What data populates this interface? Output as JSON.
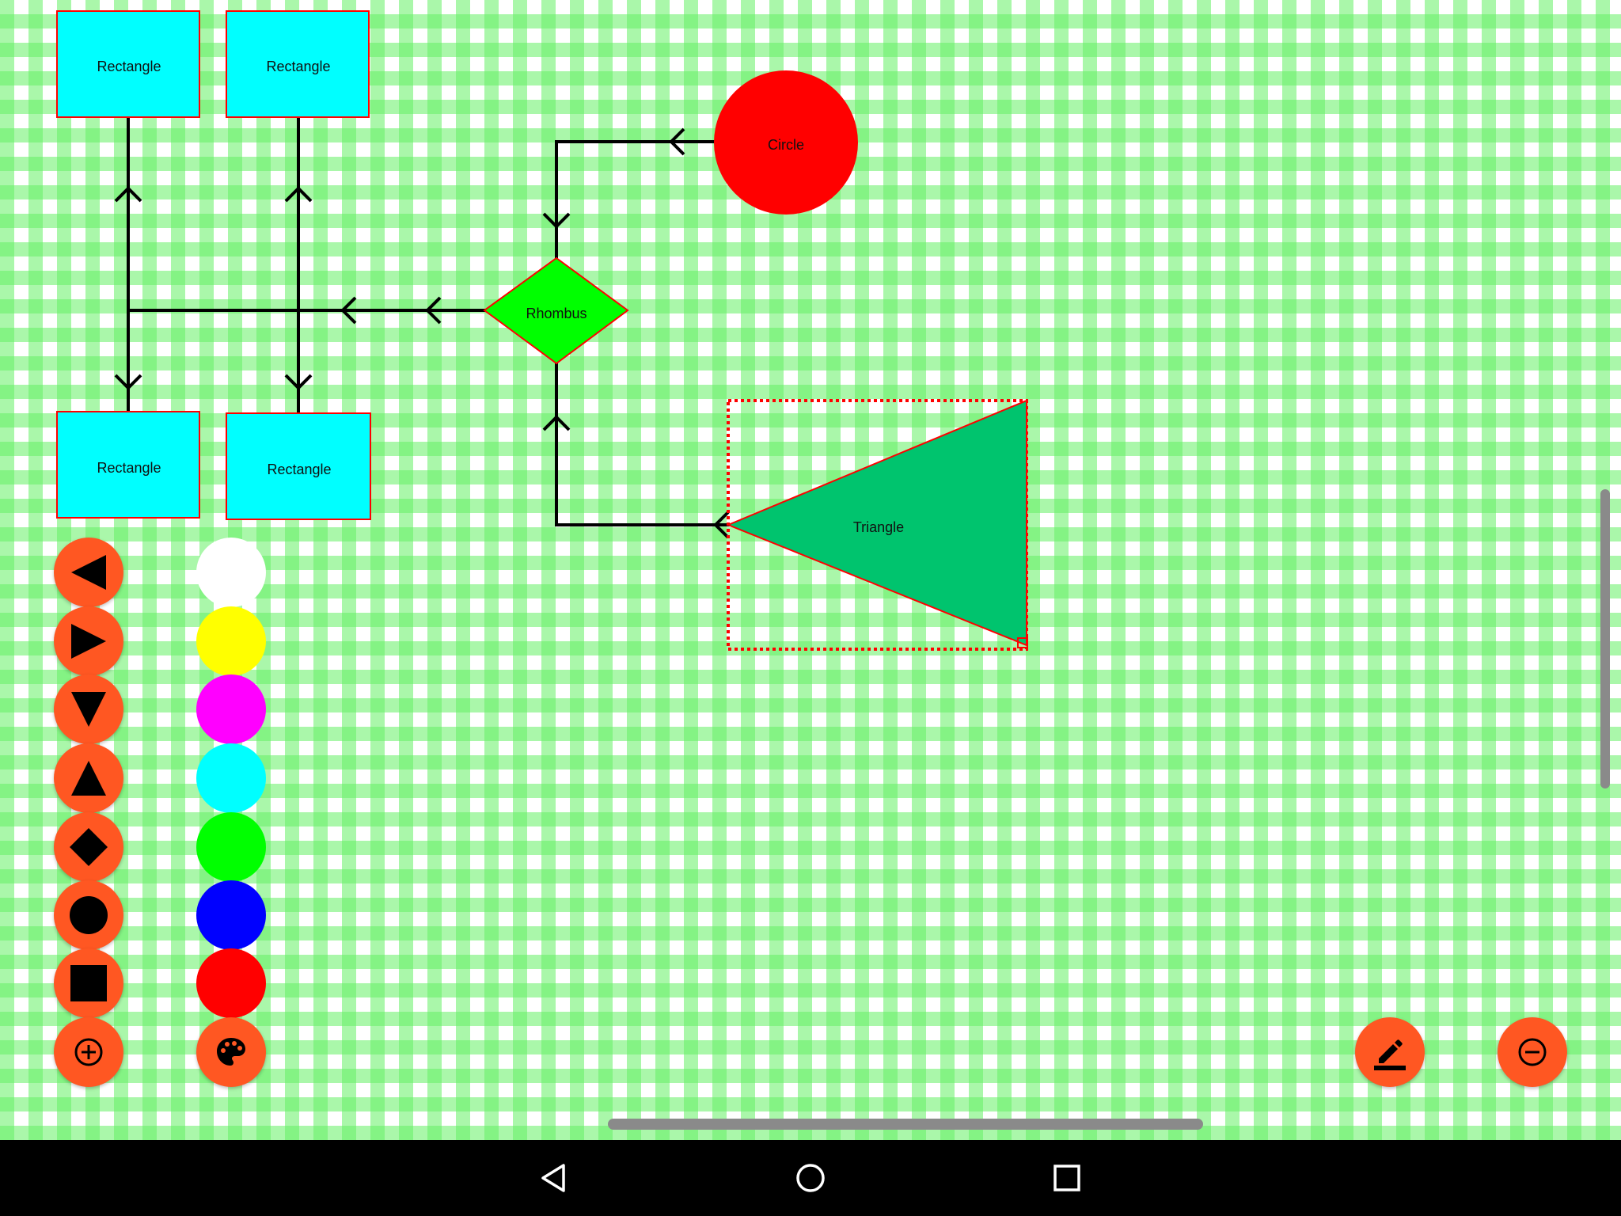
{
  "canvas": {
    "shapes": [
      {
        "id": "rect-1",
        "type": "rectangle",
        "label": "Rectangle",
        "fill": "#00ffff",
        "stroke": "#ff0000"
      },
      {
        "id": "rect-2",
        "type": "rectangle",
        "label": "Rectangle",
        "fill": "#00ffff",
        "stroke": "#ff0000"
      },
      {
        "id": "rect-3",
        "type": "rectangle",
        "label": "Rectangle",
        "fill": "#00ffff",
        "stroke": "#ff0000"
      },
      {
        "id": "rect-4",
        "type": "rectangle",
        "label": "Rectangle",
        "fill": "#00ffff",
        "stroke": "#ff0000"
      },
      {
        "id": "circle",
        "type": "circle",
        "label": "Circle",
        "fill": "#ff0000"
      },
      {
        "id": "rhombus",
        "type": "rhombus",
        "label": "Rhombus",
        "fill": "#00ff00",
        "stroke": "#ff0000"
      },
      {
        "id": "triangle",
        "type": "triangle",
        "label": "Triangle",
        "fill": "#00c46e",
        "stroke": "#ff0000",
        "selected": true
      }
    ]
  },
  "shape_tools": [
    {
      "name": "triangle-left-tool",
      "icon": "triangle-left-icon"
    },
    {
      "name": "triangle-right-tool",
      "icon": "triangle-right-icon"
    },
    {
      "name": "triangle-down-tool",
      "icon": "triangle-down-icon"
    },
    {
      "name": "triangle-up-tool",
      "icon": "triangle-up-icon"
    },
    {
      "name": "rhombus-tool",
      "icon": "diamond-icon"
    },
    {
      "name": "circle-tool",
      "icon": "circle-icon"
    },
    {
      "name": "rectangle-tool",
      "icon": "square-icon"
    },
    {
      "name": "add-shape-button",
      "icon": "add-circle-icon"
    }
  ],
  "color_palette": {
    "colors": [
      "#ffffff",
      "#ffff00",
      "#ff00ff",
      "#00ffff",
      "#00ff00",
      "#0000ff",
      "#ff0000"
    ],
    "palette_button_icon": "palette-icon"
  },
  "actions": {
    "edit_icon": "edit-pencil-icon",
    "remove_icon": "remove-circle-icon",
    "accent": "#ff5722"
  },
  "navigation_bar": {
    "back_icon": "back-icon",
    "home_icon": "home-icon",
    "recents_icon": "recents-icon"
  }
}
